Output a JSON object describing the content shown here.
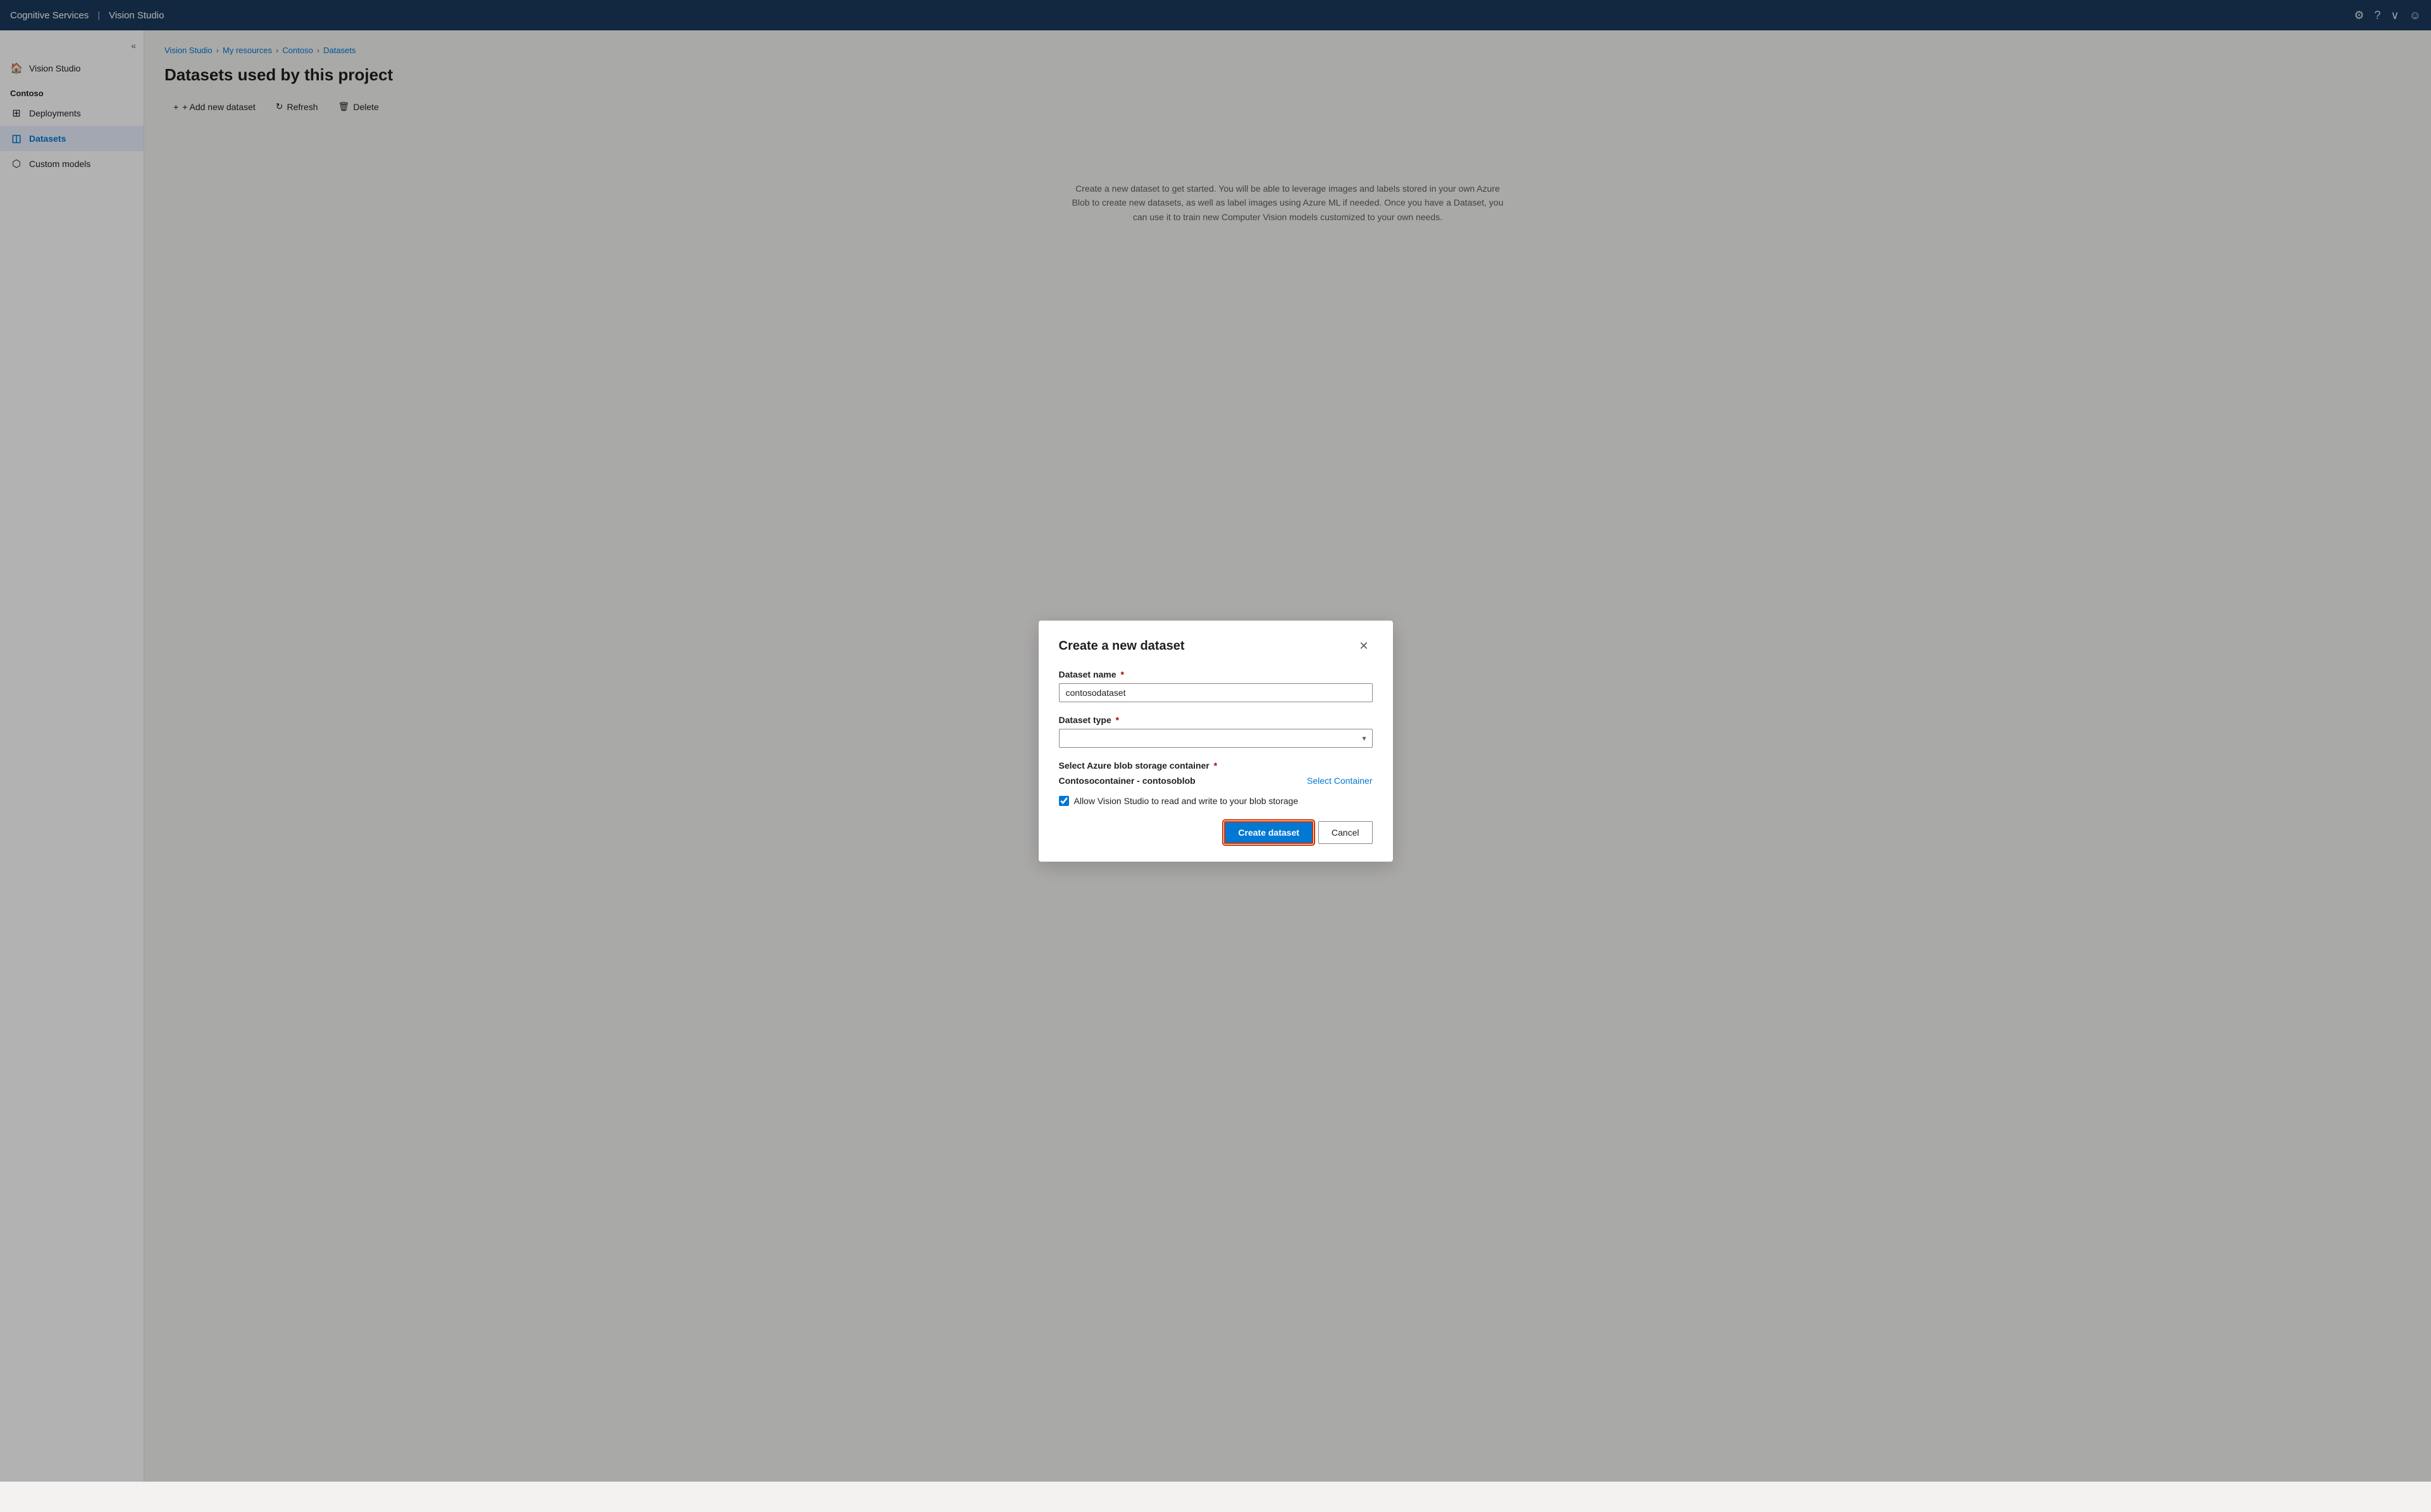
{
  "topnav": {
    "app_name": "Cognitive Services",
    "divider": "|",
    "app_subtitle": "Vision Studio",
    "icons": {
      "settings": "⚙",
      "help": "?",
      "chevron": "∨",
      "user": "☺"
    }
  },
  "sidebar": {
    "collapse_icon": "«",
    "home_item": "Vision Studio",
    "section_label": "Contoso",
    "items": [
      {
        "id": "deployments",
        "label": "Deployments",
        "icon": "⊞"
      },
      {
        "id": "datasets",
        "label": "Datasets",
        "icon": "◫"
      },
      {
        "id": "custom-models",
        "label": "Custom models",
        "icon": "⬡"
      }
    ]
  },
  "breadcrumb": {
    "items": [
      "Vision Studio",
      "My resources",
      "Contoso",
      "Datasets"
    ]
  },
  "page": {
    "title": "Datasets used by this project"
  },
  "toolbar": {
    "add_label": "+ Add new dataset",
    "refresh_label": "↻ Refresh",
    "delete_label": "🗑 Delete"
  },
  "modal": {
    "title": "Create a new dataset",
    "close_icon": "✕",
    "dataset_name_label": "Dataset name",
    "dataset_name_required": "*",
    "dataset_name_value": "contosodataset",
    "dataset_type_label": "Dataset type",
    "dataset_type_required": "*",
    "dataset_type_placeholder": "",
    "storage_label": "Select Azure blob storage container",
    "storage_required": "*",
    "storage_name": "Contosocontainer - contosoblob",
    "storage_link": "Select Container",
    "checkbox_label": "Allow Vision Studio to read and write to your blob storage",
    "create_btn": "Create dataset",
    "cancel_btn": "Cancel"
  },
  "description": "Create a new dataset to get started. You will be able to leverage images and labels stored in your own Azure Blob to create new datasets, as well as label images using Azure ML if needed. Once you have a Dataset, you can use it to train new Computer Vision models customized to your own needs."
}
